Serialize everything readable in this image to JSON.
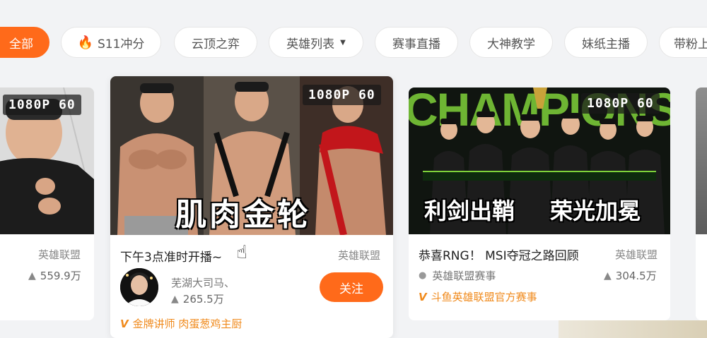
{
  "tabs": [
    {
      "label": "全部",
      "active": true
    },
    {
      "label": "S11冲分",
      "icon": "flame-icon"
    },
    {
      "label": "云顶之弈"
    },
    {
      "label": "英雄列表",
      "dropdown": true
    },
    {
      "label": "赛事直播"
    },
    {
      "label": "大神教学"
    },
    {
      "label": "妹纸主播"
    },
    {
      "label": "带粉上"
    }
  ],
  "cards": [
    {
      "resolution": "1080P 60",
      "category": "英雄联盟",
      "popularity": "559.9万"
    },
    {
      "resolution": "1080P 60",
      "thumb_text": "肌肉金轮",
      "title": "下午3点准时开播~",
      "category": "英雄联盟",
      "streamer": "芜湖大司马、",
      "popularity": "265.5万",
      "badge": "金牌讲师 肉蛋葱鸡主厨",
      "follow_label": "关注"
    },
    {
      "resolution": "1080P 60",
      "thumb_text_left": "利剑出鞘",
      "thumb_text_right": "荣光加冕",
      "title": "恭喜RNG！ MSI夺冠之路回顾",
      "category": "英雄联盟",
      "streamer": "英雄联盟赛事",
      "popularity": "304.5万",
      "badge": "斗鱼英雄联盟官方赛事"
    }
  ],
  "colors": {
    "accent": "#ff6a1a",
    "badge": "#f08a1c",
    "background": "#f2f3f5",
    "champ_green": "#7fd23a"
  }
}
